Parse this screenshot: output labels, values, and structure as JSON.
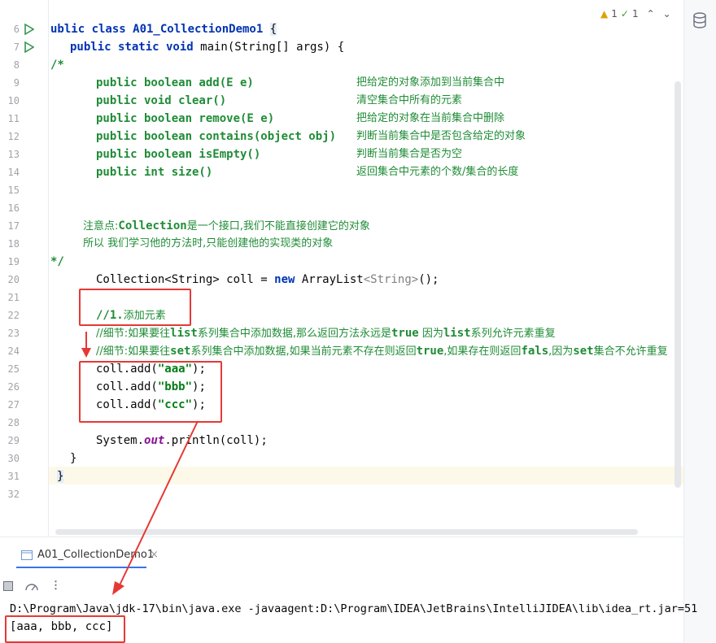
{
  "editor": {
    "lines": [
      {
        "n": "6",
        "run": true
      },
      {
        "n": "7",
        "run": true
      },
      {
        "n": "8"
      },
      {
        "n": "9"
      },
      {
        "n": "10"
      },
      {
        "n": "11"
      },
      {
        "n": "12"
      },
      {
        "n": "13"
      },
      {
        "n": "14"
      },
      {
        "n": "15"
      },
      {
        "n": "16"
      },
      {
        "n": "17"
      },
      {
        "n": "18"
      },
      {
        "n": "19"
      },
      {
        "n": "20"
      },
      {
        "n": "21"
      },
      {
        "n": "22"
      },
      {
        "n": "23"
      },
      {
        "n": "24"
      },
      {
        "n": "25"
      },
      {
        "n": "26"
      },
      {
        "n": "27"
      },
      {
        "n": "28"
      },
      {
        "n": "29"
      },
      {
        "n": "30"
      },
      {
        "n": "31"
      },
      {
        "n": "32"
      }
    ],
    "code": {
      "l6_a": "ublic class A01_CollectionDemo1 ",
      "l6_b": "{",
      "l7": "public static void main(String[] args) {",
      "l8": "/*",
      "l9_sig": "public boolean add(E e)",
      "l9_cn": "把给定的对象添加到当前集合中",
      "l10_sig": "public void clear()",
      "l10_cn": "清空集合中所有的元素",
      "l11_sig": "public boolean remove(E e)",
      "l11_cn": "把给定的对象在当前集合中删除",
      "l12_sig": "public boolean contains(object obj)",
      "l12_cn": "判断当前集合中是否包含给定的对象",
      "l13_sig": "public boolean isEmpty()",
      "l13_cn": "判断当前集合是否为空",
      "l14_sig": "public int size()",
      "l14_cn": "返回集合中元素的个数/集合的长度",
      "l17_a": "注意点:",
      "l17_b": "Collection",
      "l17_c": "是一个接口,我们不能直接创建它的对象",
      "l18": "所以 我们学习他的方法时,只能创建他的实现类的对象",
      "l19": "*/",
      "l20_a": "Collection<String> coll = ",
      "l20_b": "new",
      "l20_c": " ArrayList",
      "l20_d": "<String>",
      "l20_e": "();",
      "l22_a": "//1.",
      "l22_b": "添加元素",
      "l23_a": "//细节:如果要往",
      "l23_b": "list",
      "l23_c": "系列集合中添加数据,那么返回方法永远是",
      "l23_d": "true",
      "l23_e": " 因为",
      "l23_f": "list",
      "l23_g": "系列允许元素重复",
      "l24_a": "//细节:如果要往",
      "l24_b": "set",
      "l24_c": "系列集合中添加数据,如果当前元素不存在则返回",
      "l24_d": "true",
      "l24_e": ",如果存在则返回",
      "l24_f": "fals",
      "l24_g": ",因为",
      "l24_h": "set",
      "l24_i": "集合不允许重复",
      "l25_a": "coll.add(",
      "l25_b": "\"aaa\"",
      "l25_c": ");",
      "l26_a": "coll.add(",
      "l26_b": "\"bbb\"",
      "l26_c": ");",
      "l27_a": "coll.add(",
      "l27_b": "\"ccc\"",
      "l27_c": ");",
      "l29_a": "System.",
      "l29_b": "out",
      "l29_c": ".println(coll);",
      "l30": "}",
      "l31": "}"
    },
    "inspections": {
      "warnings": "1",
      "ok": "1"
    }
  },
  "run_panel": {
    "tab_label": "A01_CollectionDemo1",
    "console": [
      "D:\\Program\\Java\\jdk-17\\bin\\java.exe -javaagent:D:\\Program\\IDEA\\JetBrains\\IntelliJIDEA\\lib\\idea_rt.jar=51",
      "[aaa, bbb, ccc]"
    ]
  },
  "colors": {
    "keyword": "#0033b3",
    "comment": "#1f8c36",
    "string": "#067d17",
    "annotation": "#e53935"
  }
}
